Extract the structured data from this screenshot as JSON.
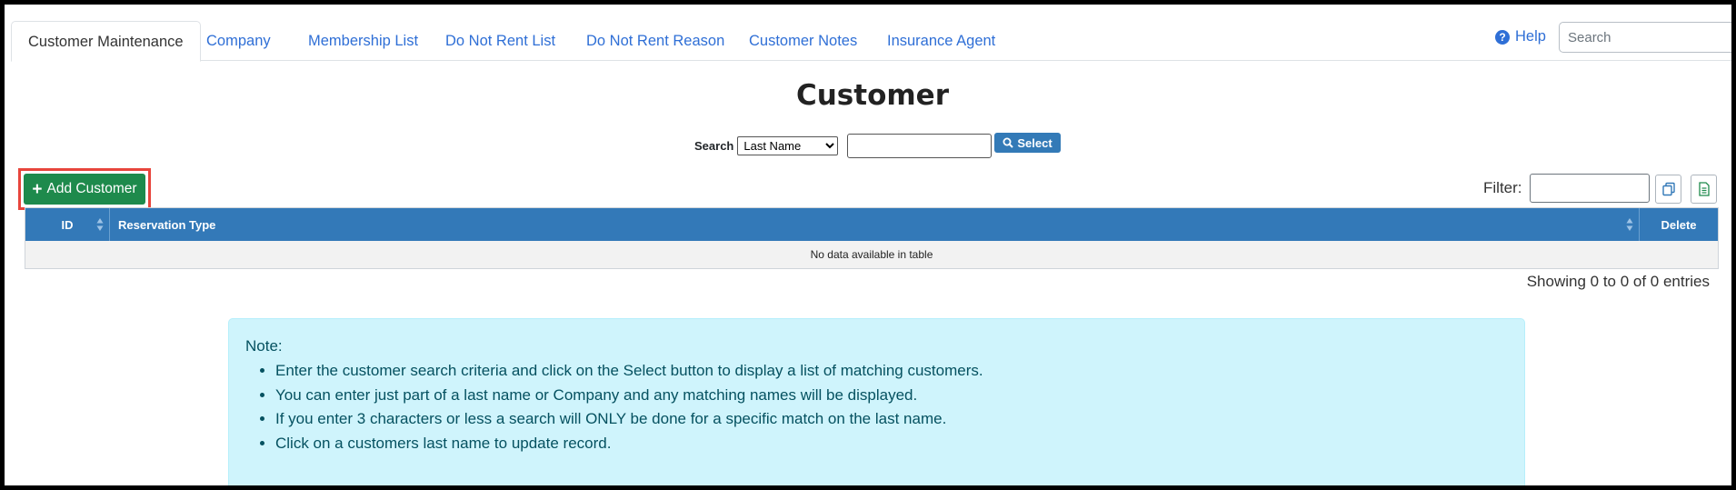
{
  "tabs": [
    {
      "label": "Customer Maintenance",
      "active": true
    },
    {
      "label": "Company",
      "active": false
    },
    {
      "label": "Membership List",
      "active": false
    },
    {
      "label": "Do Not Rent List",
      "active": false
    },
    {
      "label": "Do Not Rent Reason",
      "active": false
    },
    {
      "label": "Customer Notes",
      "active": false
    },
    {
      "label": "Insurance Agent",
      "active": false
    }
  ],
  "header": {
    "help_label": "Help",
    "search_placeholder": "Search"
  },
  "page": {
    "title": "Customer"
  },
  "customer_search": {
    "label": "Search",
    "field_selected": "Last Name",
    "query_value": "",
    "select_label": "Select"
  },
  "toolbar": {
    "add_label": "Add Customer",
    "filter_label": "Filter:",
    "filter_value": ""
  },
  "table": {
    "columns": [
      "ID",
      "Reservation Type",
      "Delete"
    ],
    "empty_message": "No data available in table",
    "info": "Showing 0 to 0 of 0 entries"
  },
  "note": {
    "title": "Note:",
    "items": [
      "Enter the customer search criteria and click on the Select button to display a list of matching customers.",
      "You can enter just part of a last name or Company and any matching names will be displayed.",
      "If you enter 3 characters or less a search will ONLY be done for a specific match on the last name.",
      "Click on a customers last name to update record."
    ]
  },
  "colors": {
    "tab_link": "#2f6fd6",
    "table_header": "#3379b8",
    "add_button": "#1e8a4c",
    "highlight_box": "#e8453c",
    "note_background": "#cff4fc",
    "note_text": "#055160"
  }
}
